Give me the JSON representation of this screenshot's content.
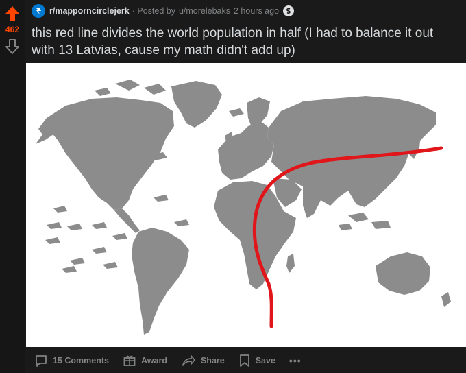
{
  "post": {
    "score": "462",
    "subreddit": "r/mapporncirclejerk",
    "meta_prefix": "· Posted by",
    "author": "u/morelebaks",
    "time_ago": "2 hours ago",
    "title_line1": "this red line divides the world population in half (I had to balance it out",
    "title_line2": "with 13 Latvias, cause my math didn't add up)"
  },
  "actions": {
    "comments_label": "15 Comments",
    "award_label": "Award",
    "share_label": "Share",
    "save_label": "Save",
    "more_label": "•••"
  },
  "colors": {
    "upvote": "#ff4500",
    "background": "#1a1a1b",
    "text": "#d7dadc",
    "muted": "#818384",
    "land": "#8c8c8c",
    "divider_line": "#e0161b"
  },
  "icons": {
    "upvote": "arrow-up-icon",
    "downvote": "arrow-down-icon",
    "subreddit": "subreddit-icon",
    "award_badge": "silver-award-icon",
    "comments": "comment-bubble-icon",
    "award": "gift-icon",
    "share": "share-arrow-icon",
    "save": "bookmark-icon"
  }
}
